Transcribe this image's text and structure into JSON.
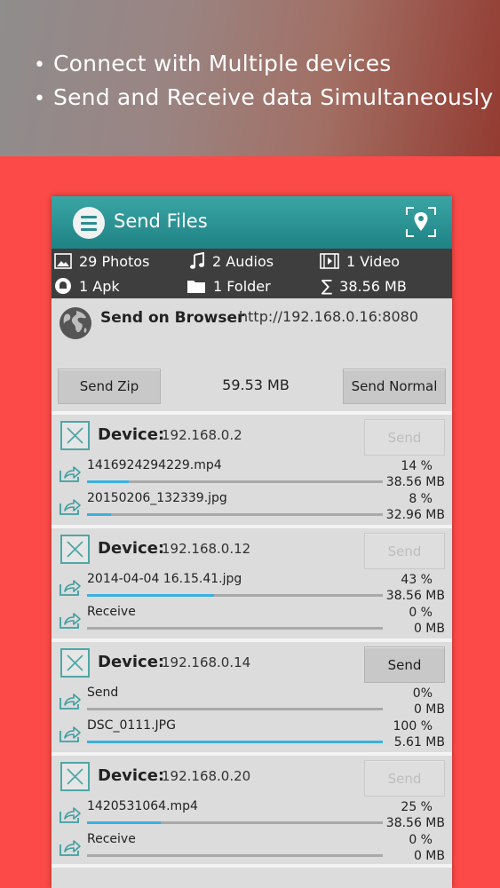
{
  "promo": {
    "bullets": [
      "Connect with Multiple devices",
      "Send and Receive data Simultaneously"
    ]
  },
  "appbar": {
    "title": "Send Files",
    "menu_icon": "hamburger-menu-icon",
    "location_icon": "location-pin-icon"
  },
  "summary": {
    "photos": "29 Photos",
    "audios": "2 Audios",
    "video": "1 Video",
    "apk": "1 Apk",
    "folder": "1 Folder",
    "total": "38.56 MB"
  },
  "browser": {
    "title": "Send on Browser",
    "url": "http://192.168.0.16:8080",
    "send_zip_label": "Send Zip",
    "zip_size": "59.53 MB",
    "send_normal_label": "Send Normal"
  },
  "devices": [
    {
      "label": "Device:",
      "ip": "192.168.0.2",
      "send_label": "Send",
      "send_enabled": false,
      "transfers": [
        {
          "name": "1416924294229.mp4",
          "percent": "14 %",
          "size": "38.56 MB",
          "progress": 14
        },
        {
          "name": "20150206_132339.jpg",
          "percent": "8 %",
          "size": "32.96 MB",
          "progress": 8
        }
      ]
    },
    {
      "label": "Device:",
      "ip": "192.168.0.12",
      "send_label": "Send",
      "send_enabled": false,
      "transfers": [
        {
          "name": "2014-04-04 16.15.41.jpg",
          "percent": "43 %",
          "size": "38.56 MB",
          "progress": 43
        },
        {
          "name": "Receive",
          "percent": "0 %",
          "size": "0 MB",
          "progress": 0
        }
      ]
    },
    {
      "label": "Device:",
      "ip": "192.168.0.14",
      "send_label": "Send",
      "send_enabled": true,
      "transfers": [
        {
          "name": "Send",
          "percent": "0%",
          "size": "0 MB",
          "progress": 0
        },
        {
          "name": "DSC_0111.JPG",
          "percent": "100 %",
          "size": "5.61 MB",
          "progress": 100
        }
      ]
    },
    {
      "label": "Device:",
      "ip": "192.168.0.20",
      "send_label": "Send",
      "send_enabled": false,
      "transfers": [
        {
          "name": "1420531064.mp4",
          "percent": "25 %",
          "size": "38.56 MB",
          "progress": 25
        },
        {
          "name": "Receive",
          "percent": "0 %",
          "size": "0 MB",
          "progress": 0
        }
      ]
    }
  ],
  "colors": {
    "background": "#fb4a47",
    "appbar": "#2a8d8f",
    "progress": "#3ab0e0"
  }
}
